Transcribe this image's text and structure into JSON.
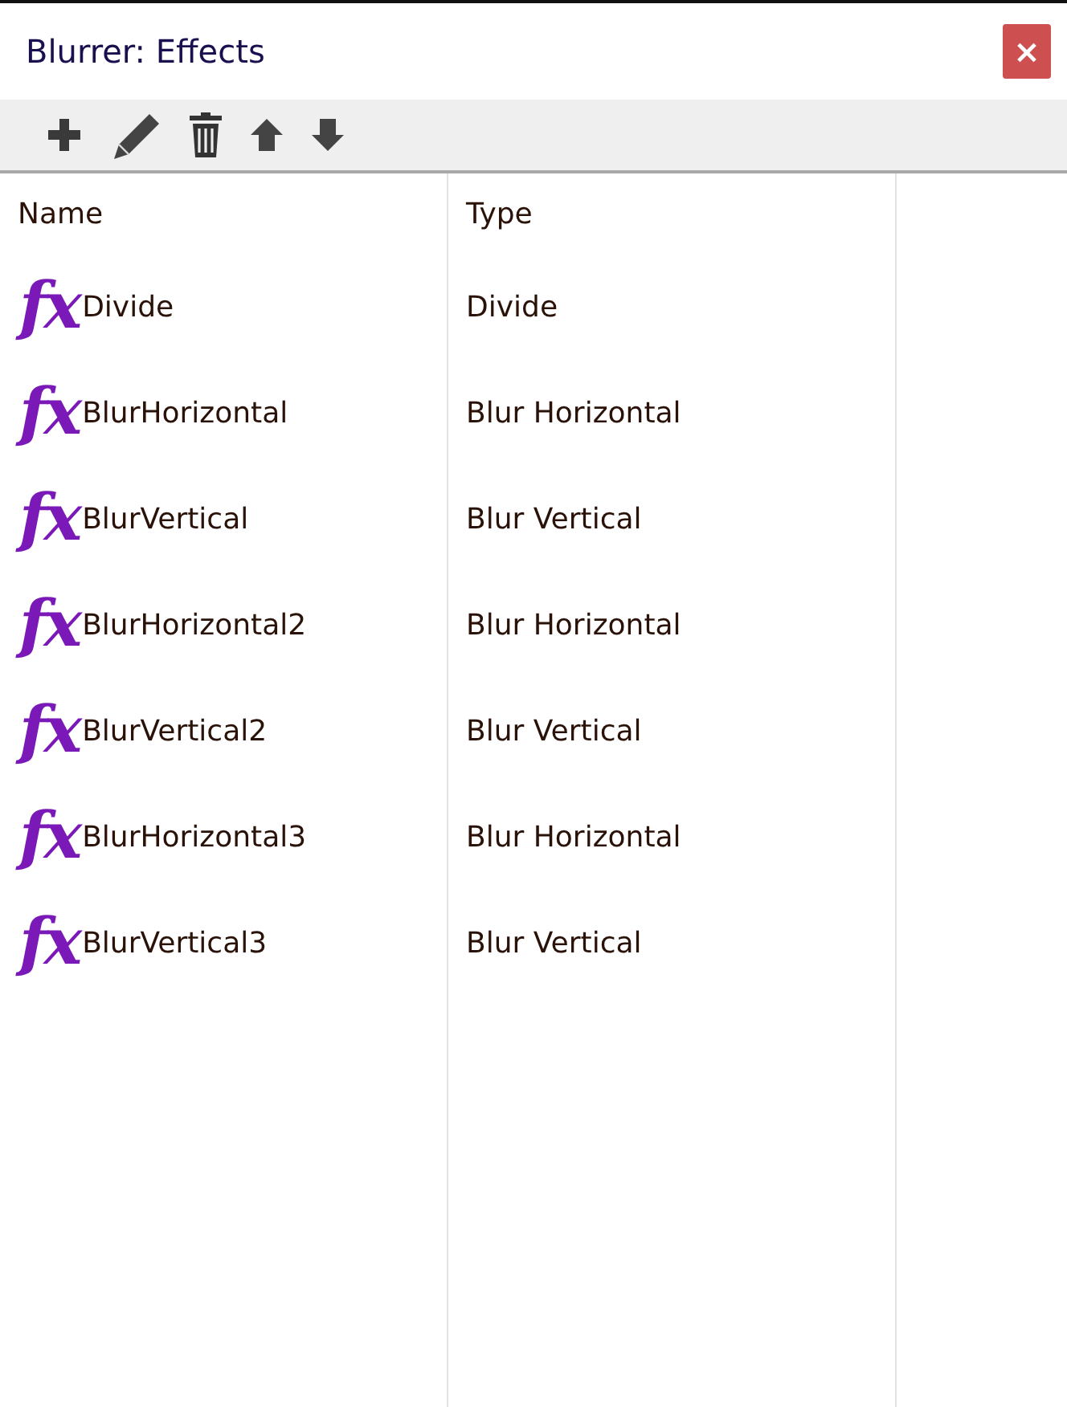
{
  "window": {
    "title": "Blurrer: Effects",
    "close": "×"
  },
  "table": {
    "columns": [
      "Name",
      "Type"
    ],
    "rows": [
      {
        "icon": "fx",
        "name": "Divide",
        "type": "Divide"
      },
      {
        "icon": "fx",
        "name": "BlurHorizontal",
        "type": "Blur Horizontal"
      },
      {
        "icon": "fx",
        "name": "BlurVertical",
        "type": "Blur Vertical"
      },
      {
        "icon": "fx",
        "name": "BlurHorizontal2",
        "type": "Blur Horizontal"
      },
      {
        "icon": "fx",
        "name": "BlurVertical2",
        "type": "Blur Vertical"
      },
      {
        "icon": "fx",
        "name": "BlurHorizontal3",
        "type": "Blur Horizontal"
      },
      {
        "icon": "fx",
        "name": "BlurVertical3",
        "type": "Blur Vertical"
      }
    ]
  }
}
